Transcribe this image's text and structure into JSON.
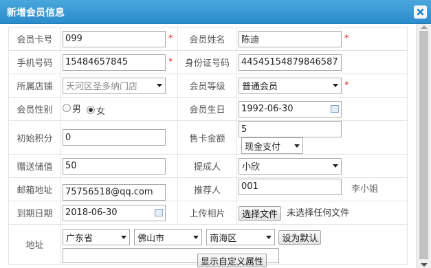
{
  "dialog": {
    "title": "新增会员信息"
  },
  "fields": {
    "card_no": {
      "label": "会员卡号",
      "value": "099"
    },
    "name": {
      "label": "会员姓名",
      "value": "陈迪"
    },
    "phone": {
      "label": "手机号码",
      "value": "15484657845"
    },
    "id_no": {
      "label": "身份证号码",
      "value": "44545154879846587"
    },
    "store": {
      "label": "所属店铺",
      "value": "天河区圣多纳门店"
    },
    "level": {
      "label": "会员等级",
      "value": "普通会员"
    },
    "gender": {
      "label": "会员性别",
      "options": [
        "男",
        "女"
      ],
      "selected": "女"
    },
    "birthday": {
      "label": "会员生日",
      "value": "1992-06-30"
    },
    "init_points": {
      "label": "初始积分",
      "value": "0"
    },
    "card_amount": {
      "label": "售卡金额",
      "value": "5",
      "pay_method": "现金支付"
    },
    "gift_value": {
      "label": "赠送储值",
      "value": "50"
    },
    "proposer": {
      "label": "提成人",
      "value": "小欣"
    },
    "email": {
      "label": "邮箱地址",
      "value": "75756518@qq.com"
    },
    "referrer": {
      "label": "推荐人",
      "value": "001",
      "name": "李小姐"
    },
    "expire": {
      "label": "到期日期",
      "value": "2018-06-30"
    },
    "photo": {
      "label": "上传相片",
      "button": "选择文件",
      "status": "未选择任何文件"
    },
    "address": {
      "label": "地址",
      "province": "广东省",
      "city": "佛山市",
      "district": "南海区",
      "default_button": "设为默认",
      "detail": ""
    }
  },
  "required_mark": "*",
  "custom_attr_button": "显示自定义属性",
  "icons": {
    "close": "close-icon",
    "calendar": "calendar-icon",
    "dropdown": "chevron-down-icon"
  }
}
